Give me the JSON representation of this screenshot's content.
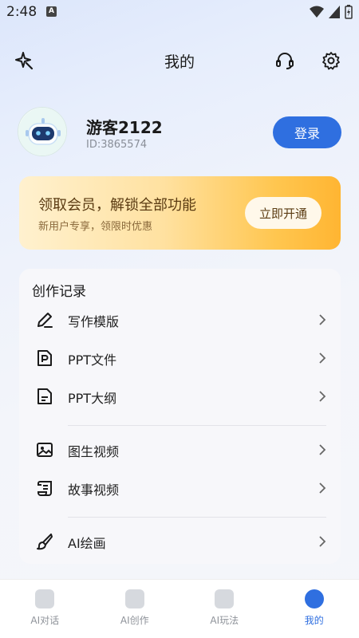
{
  "status_bar": {
    "time": "2:48",
    "badge": "A"
  },
  "header": {
    "title": "我的"
  },
  "profile": {
    "name": "游客2122",
    "id": "ID:3865574",
    "login_label": "登录"
  },
  "vip": {
    "title": "领取会员，解锁全部功能",
    "subtitle": "新用户专享，领限时优惠",
    "button_label": "立即开通"
  },
  "records": {
    "title": "创作记录",
    "items": [
      {
        "label": "写作模版",
        "icon": "pen-icon"
      },
      {
        "label": "PPT文件",
        "icon": "ppt-file-icon"
      },
      {
        "label": "PPT大纲",
        "icon": "outline-doc-icon"
      },
      {
        "label": "图生视频",
        "icon": "image-icon"
      },
      {
        "label": "故事视频",
        "icon": "scroll-icon"
      },
      {
        "label": "AI绘画",
        "icon": "brush-icon"
      }
    ]
  },
  "tabs": [
    {
      "label": "AI对话",
      "active": false
    },
    {
      "label": "AI创作",
      "active": false
    },
    {
      "label": "AI玩法",
      "active": false
    },
    {
      "label": "我的",
      "active": true
    }
  ],
  "colors": {
    "accent": "#2f6fe0",
    "vip_start": "#fff1cf",
    "vip_end": "#ffb532"
  }
}
